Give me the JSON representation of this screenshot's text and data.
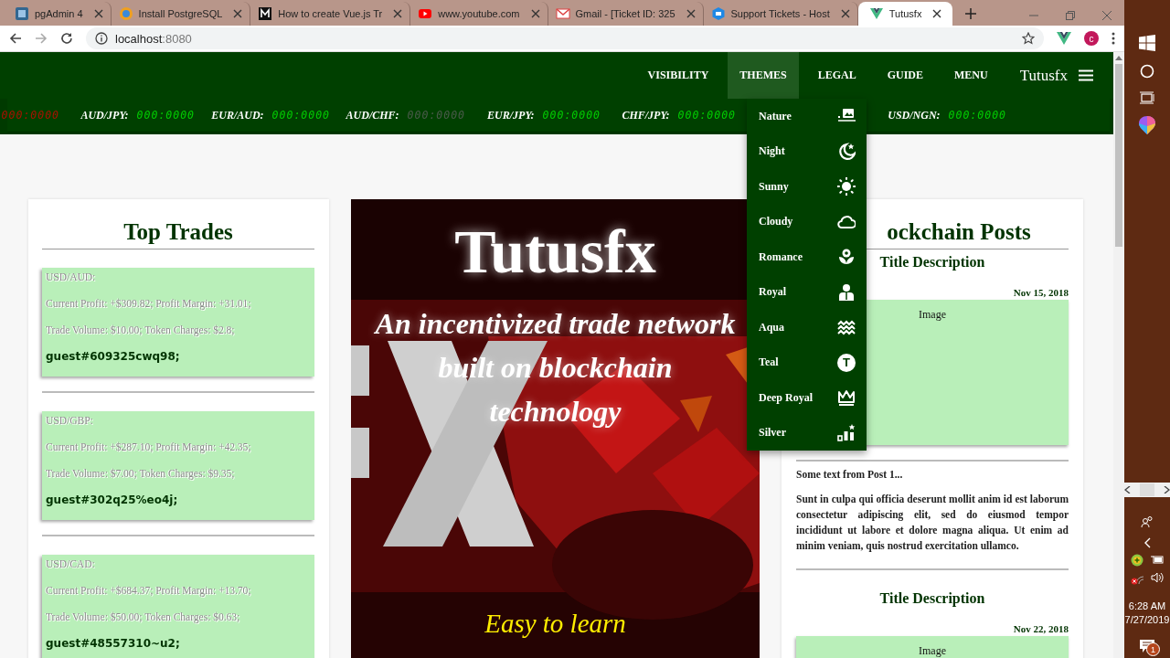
{
  "browser": {
    "tabs": [
      {
        "title": "pgAdmin 4",
        "selected": false
      },
      {
        "title": "Install PostgreSQL",
        "selected": false
      },
      {
        "title": "How to create Vue.js Tr",
        "selected": false
      },
      {
        "title": "www.youtube.com",
        "selected": false
      },
      {
        "title": "Gmail - [Ticket ID: 325",
        "selected": false
      },
      {
        "title": "Support Tickets - Host",
        "selected": false
      },
      {
        "title": "Tutusfx",
        "selected": true
      }
    ],
    "address": {
      "host": "localhost",
      "port": ":8080"
    },
    "profile_initial": "c"
  },
  "nav": {
    "items": [
      {
        "label": "VISIBILITY",
        "selected": false
      },
      {
        "label": "THEMES",
        "selected": true
      },
      {
        "label": "LEGAL",
        "selected": false
      },
      {
        "label": "GUIDE",
        "selected": false
      },
      {
        "label": "MENU",
        "selected": false
      }
    ],
    "brand": "Tutusfx"
  },
  "ticker": [
    {
      "value": "000:0000",
      "color": "#aa1100"
    },
    {
      "pair": "AUD/JPY:",
      "value": "000:0000",
      "color": "#00cc00"
    },
    {
      "pair": "EUR/AUD:",
      "value": "000:0000",
      "color": "#00cc00"
    },
    {
      "pair": "AUD/CHF:",
      "value": "000:0000",
      "color": "#4a5a4a"
    },
    {
      "pair": "EUR/JPY:",
      "value": "000:0000",
      "color": "#00cc00"
    },
    {
      "pair": "CHF/JPY:",
      "value": "000:0000",
      "color": "#00cc00"
    },
    {
      "pair": "USD/NGN:",
      "value": "000:0000",
      "color": "#00cc00"
    }
  ],
  "themes_menu": {
    "items": [
      {
        "label": "Nature"
      },
      {
        "label": "Night"
      },
      {
        "label": "Sunny"
      },
      {
        "label": "Cloudy"
      },
      {
        "label": "Romance"
      },
      {
        "label": "Royal"
      },
      {
        "label": "Aqua"
      },
      {
        "label": "Teal",
        "icon_char": "T"
      },
      {
        "label": "Deep Royal"
      },
      {
        "label": "Silver"
      }
    ]
  },
  "top_trades": {
    "title": "Top Trades",
    "trades": [
      {
        "pair": "USD/AUD:",
        "profit": "Current Profit: +$309.82; Profit Margin: +31.01;",
        "volume": "Trade Volume: $10.00; Token Charges: $2.8;",
        "user": "guest#609325cwq98;"
      },
      {
        "pair": "USD/GBP:",
        "profit": "Current Profit: +$287.10; Profit Margin: +42.35;",
        "volume": "Trade Volume: $7.00; Token Charges: $9.35;",
        "user": "guest#302q25%eo4j;"
      },
      {
        "pair": "USD/CAD:",
        "profit": "Current Profit: +$684.37; Profit Margin: +13.70;",
        "volume": "Trade Volume: $50.00; Token Charges: $0.63;",
        "user": "guest#48557310~u2;"
      }
    ]
  },
  "hero": {
    "kind": "picture",
    "title": "Tutusfx",
    "tagline": "An incentivized trade network built on blockchain technology",
    "caption": "Easy to learn"
  },
  "posts": {
    "title": "ockchain Posts",
    "items": [
      {
        "title": "Title Description",
        "date": "Nov 15, 2018",
        "image_label": "Image",
        "excerpt": "Some text from Post 1...",
        "body": "Sunt in culpa qui officia deserunt mollit anim id est laborum consectetur adipiscing elit, sed do eiusmod tempor incididunt ut labore et dolore magna aliqua. Ut enim ad minim veniam, quis nostrud exercitation ullamco."
      },
      {
        "title": "Title Description",
        "date": "Nov 22, 2018",
        "image_label": "Image"
      }
    ]
  },
  "taskbar": {
    "time": "6:28 AM",
    "date": "7/27/2019",
    "notifications": "1"
  }
}
